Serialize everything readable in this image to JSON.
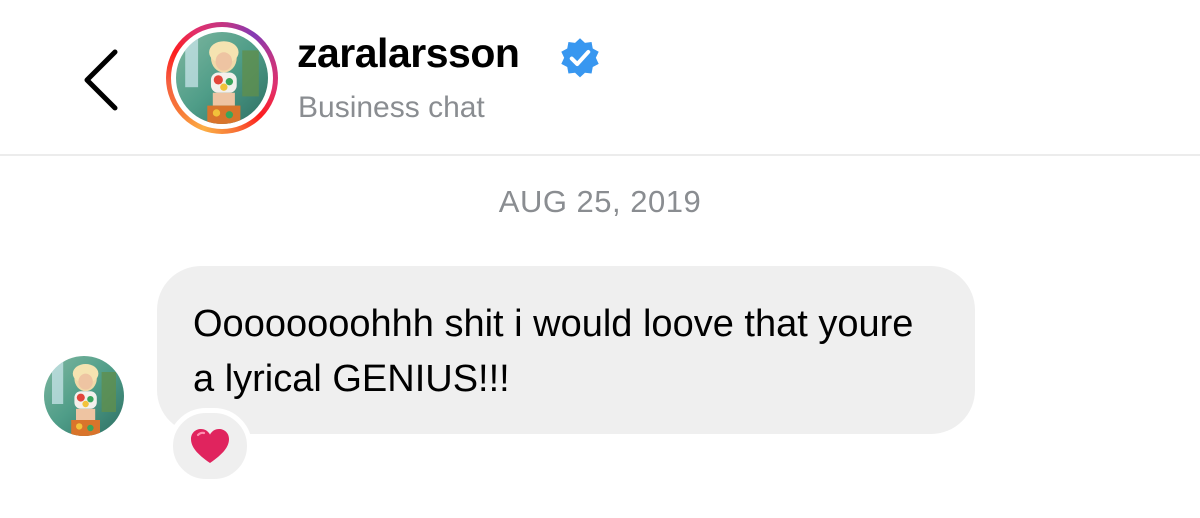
{
  "header": {
    "back_icon": "chevron-left-icon",
    "username": "zaralarsson",
    "verified_icon": "verified-badge-icon",
    "subtitle": "Business chat"
  },
  "thread": {
    "date": "AUG 25, 2019",
    "messages": [
      {
        "text": "Oooooooohhh shit i would loove that youre a lyrical GENIUS!!!",
        "reaction_icon": "heart-icon",
        "reaction_color": "#e0245e"
      }
    ]
  },
  "colors": {
    "verified_blue": "#3897f0",
    "bubble_gray": "#efefef",
    "secondary_text": "#8a8d91"
  }
}
